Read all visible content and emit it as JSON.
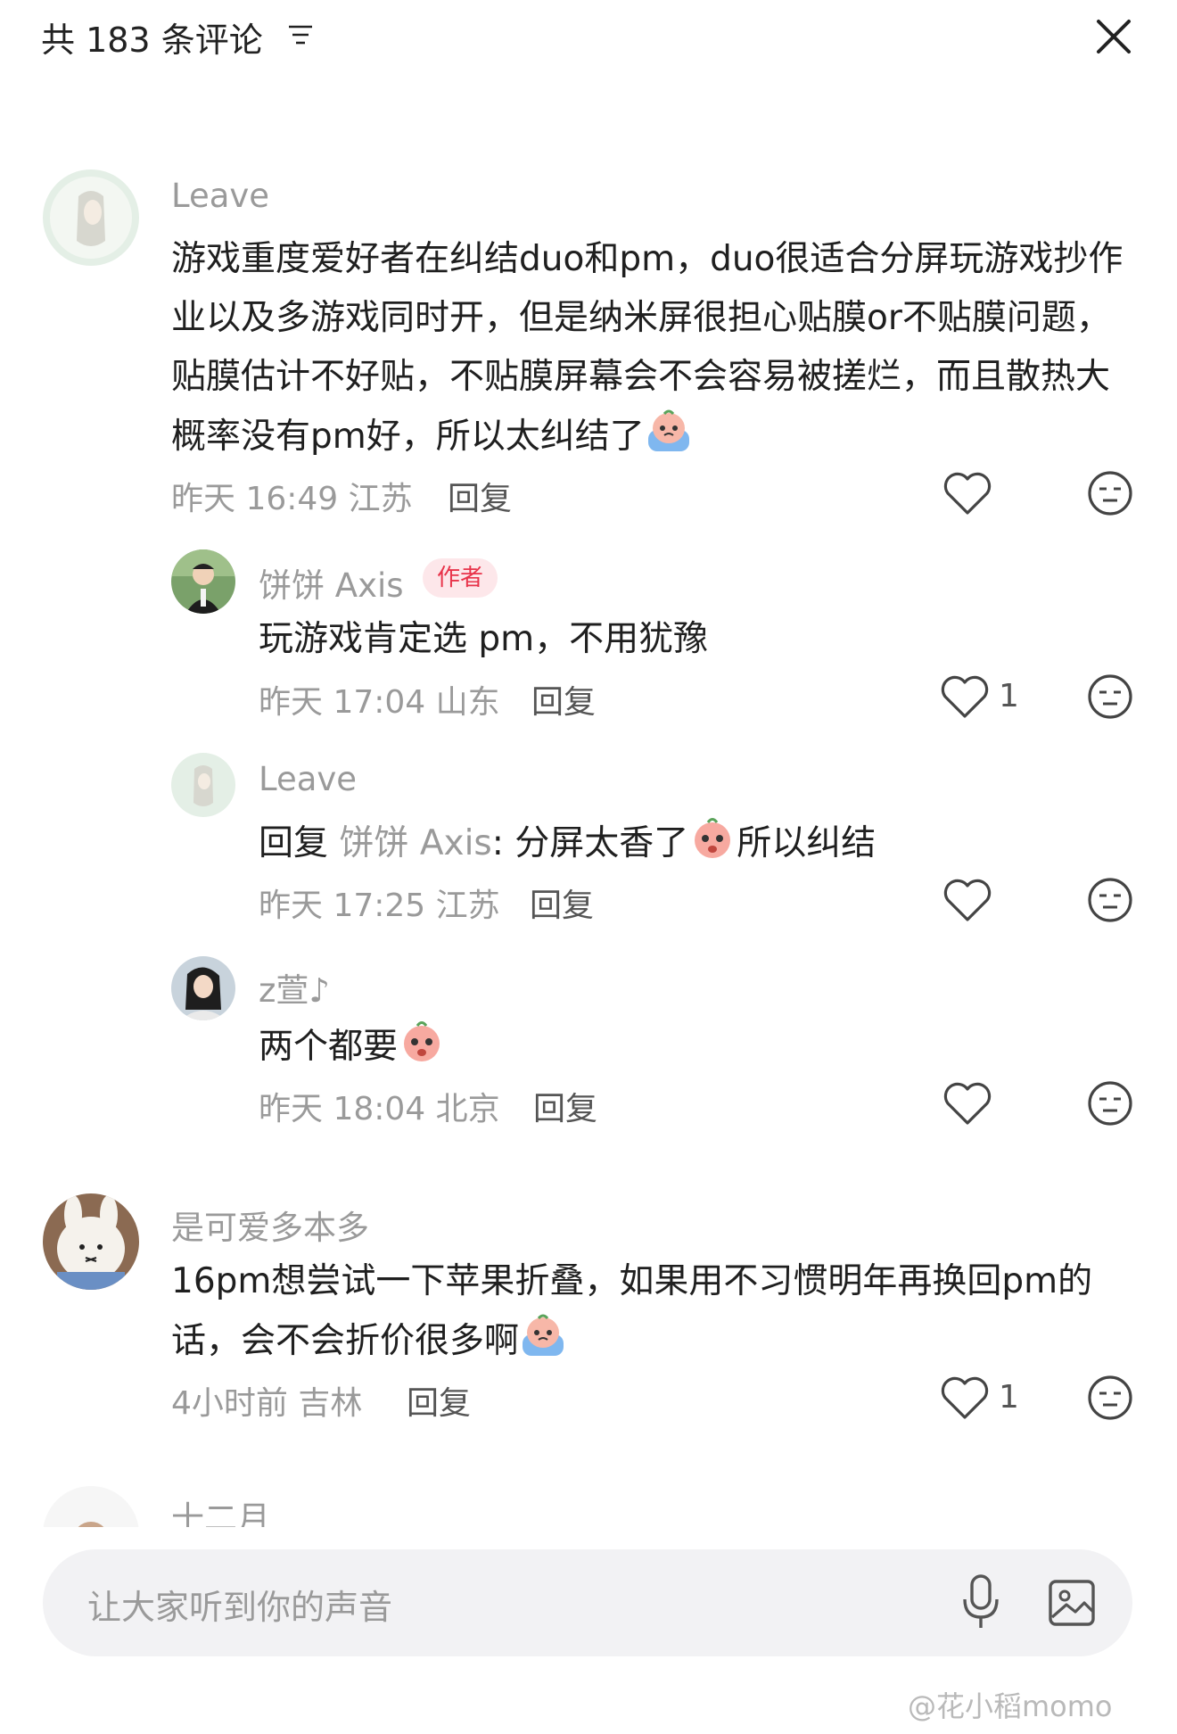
{
  "header": {
    "title": "共 183 条评论",
    "sort_icon": "sort-lines-icon",
    "close_icon": "close-icon"
  },
  "comments": [
    {
      "username": "Leave",
      "text": "游戏重度爱好者在纠结duo和pm，duo很适合分屏玩游戏抄作业以及多游戏同时开，但是纳米屏很担心贴膜or不贴膜问题，贴膜估计不好贴，不贴膜屏幕会不会容易被搓烂，而且散热大概率没有pm好，所以太纠结了",
      "time": "昨天 16:49",
      "location": "江苏",
      "reply_label": "回复",
      "like_count": ""
    },
    {
      "username": "饼饼 Axis",
      "badge": "作者",
      "text": "玩游戏肯定选 pm，不用犹豫",
      "time": "昨天 17:04",
      "location": "山东",
      "reply_label": "回复",
      "like_count": "1"
    },
    {
      "username": "Leave",
      "reply_prefix": "回复",
      "reply_target": "饼饼 Axis",
      "text_a": ": 分屏太香了",
      "text_b": "所以纠结",
      "time": "昨天 17:25",
      "location": "江苏",
      "reply_label": "回复",
      "like_count": ""
    },
    {
      "username": "z萱♪",
      "text": "两个都要",
      "time": "昨天 18:04",
      "location": "北京",
      "reply_label": "回复",
      "like_count": ""
    },
    {
      "username": "是可爱多本多",
      "text": "16pm想尝试一下苹果折叠，如果用不习惯明年再换回pm的话，会不会折价很多啊",
      "time": "4小时前",
      "location": "吉林",
      "reply_label": "回复",
      "like_count": "1"
    },
    {
      "username": "十二月"
    }
  ],
  "input": {
    "placeholder": "让大家听到你的声音"
  },
  "watermark": "@花小稻momo",
  "colors": {
    "accent": "#e8334a",
    "meta_gray": "#9a9a9a",
    "input_bg": "#f2f2f4"
  }
}
